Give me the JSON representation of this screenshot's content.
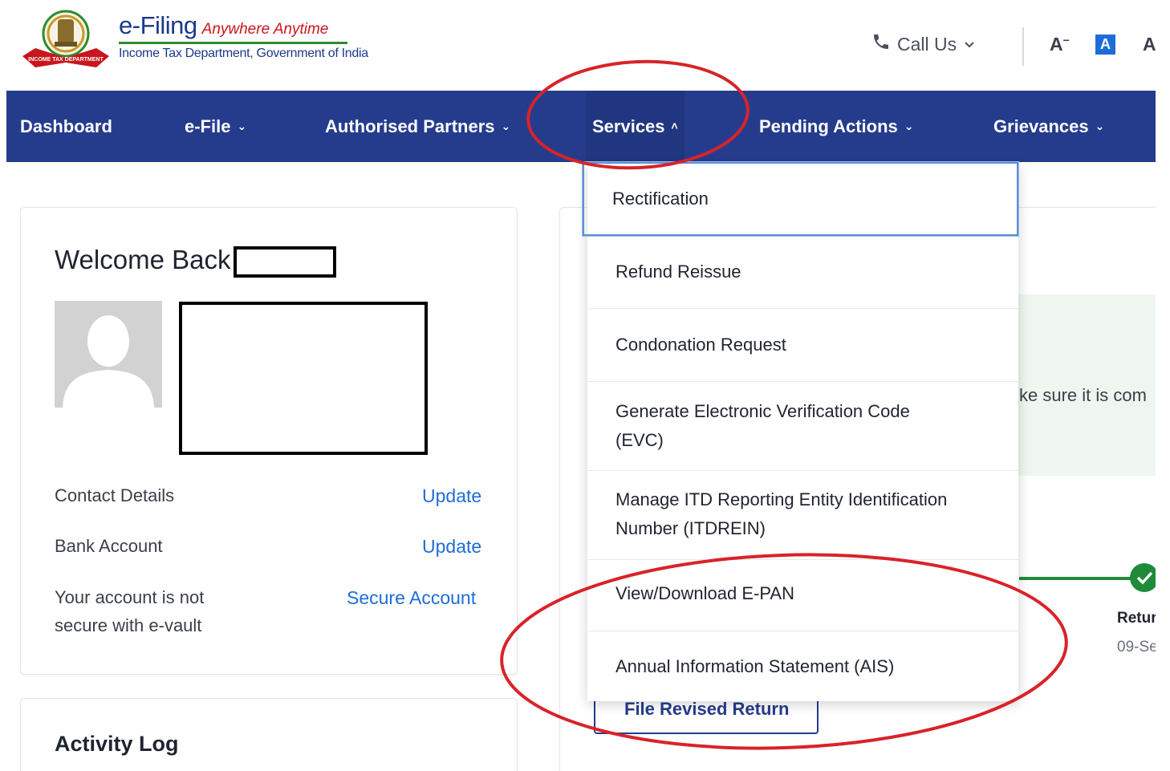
{
  "header": {
    "brand_title": "e-Filing",
    "brand_tagline": "Anywhere Anytime",
    "department": "Income Tax Department, Government of India",
    "emblem_ribbon": "INCOME TAX DEPARTMENT",
    "call_us": "Call Us",
    "font_decrease": "A",
    "font_normal": "A",
    "font_increase": "A"
  },
  "nav": {
    "items": [
      {
        "label": "Dashboard"
      },
      {
        "label": "e-File"
      },
      {
        "label": "Authorised Partners"
      },
      {
        "label": "Services"
      },
      {
        "label": "Pending Actions"
      },
      {
        "label": "Grievances"
      }
    ]
  },
  "services_menu": {
    "items": [
      {
        "label": "Rectification"
      },
      {
        "label": "Refund Reissue"
      },
      {
        "label": "Condonation Request"
      },
      {
        "label": "Generate Electronic Verification Code",
        "label2": "(EVC)"
      },
      {
        "label": "Manage ITD Reporting Entity Identification",
        "label2": "Number (ITDREIN)"
      },
      {
        "label": "View/Download E-PAN"
      },
      {
        "label": "Annual Information Statement (AIS)"
      }
    ]
  },
  "profile": {
    "welcome": "Welcome Back",
    "contact_label": "Contact Details",
    "contact_action": "Update",
    "bank_label": "Bank Account",
    "bank_action": "Update",
    "vault_label_1": "Your account is not",
    "vault_label_2": "secure with e-vault",
    "vault_action": "Secure Account"
  },
  "activity": {
    "title": "Activity Log"
  },
  "right_panel": {
    "notice_fragment": "ke sure it is com",
    "timeline_label": "Retur",
    "timeline_date": "09-Se",
    "revised_button": "File Revised Return"
  },
  "colors": {
    "nav_bg": "#253c8d",
    "link": "#1e6dd6",
    "annotation": "#d8232a",
    "success": "#1f8a3a"
  }
}
